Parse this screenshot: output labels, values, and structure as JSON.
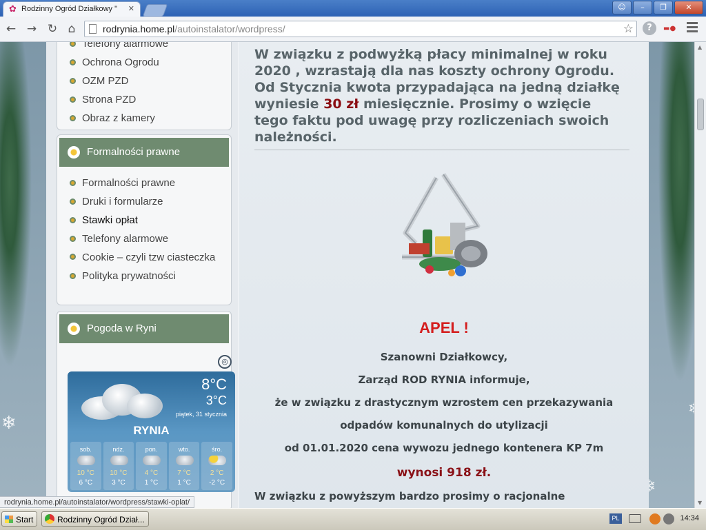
{
  "browser": {
    "tab_title": "Rodzinny Ogród Działkowy \"",
    "url_host": "rodrynia.home.pl",
    "url_path": "/autoinstalator/wordpress/",
    "status_url": "rodrynia.home.pl/autoinstalator/wordpress/stawki-oplat/"
  },
  "sidebar": {
    "menu_top": [
      {
        "label": "Telefony alarmowe"
      },
      {
        "label": "Ochrona Ogrodu"
      },
      {
        "label": "OZM PZD"
      },
      {
        "label": "Strona PZD"
      },
      {
        "label": "Obraz z kamery"
      }
    ],
    "formalnosci": {
      "title": "Formalności prawne",
      "items": [
        {
          "label": "Formalności prawne"
        },
        {
          "label": "Druki i formularze"
        },
        {
          "label": "Stawki opłat"
        },
        {
          "label": "Telefony alarmowe"
        },
        {
          "label": "Cookie – czyli tzw ciasteczka"
        },
        {
          "label": "Polityka prywatności"
        }
      ]
    },
    "weather_box": {
      "title": "Pogoda w Ryni"
    }
  },
  "weather": {
    "temp_high": "8°C",
    "temp_low": "3°C",
    "date": "piątek, 31 stycznia",
    "city": "RYNIA",
    "forecast": [
      {
        "day": "sob.",
        "high": "10 °C",
        "low": "6 °C",
        "icon": "cloud-icon"
      },
      {
        "day": "ndz.",
        "high": "10 °C",
        "low": "3 °C",
        "icon": "cloud-icon"
      },
      {
        "day": "pon.",
        "high": "4 °C",
        "low": "1 °C",
        "icon": "cloud-rain-icon"
      },
      {
        "day": "wto.",
        "high": "7 °C",
        "low": "1 °C",
        "icon": "cloud-icon"
      },
      {
        "day": "śro.",
        "high": "2 °C",
        "low": "-2 °C",
        "icon": "sun-cloud-icon"
      }
    ]
  },
  "content": {
    "intro_before": "W związku z podwyżką płacy minimalnej w roku 2020 , wzrastają dla nas koszty ochrony Ogrodu. Od Stycznia kwota przypadająca na jedną działkę wyniesie ",
    "intro_amount": "30 zł",
    "intro_after": " miesięcznie. Prosimy o wzięcie tego faktu pod uwagę przy  rozliczeniach swoich należności.",
    "apel": "APEL !",
    "lines": [
      "Szanowni Działkowcy,",
      "Zarząd ROD RYNIA informuje,",
      "że w związku z drastycznym wzrostem cen przekazywania",
      "odpadów komunalnych do utylizacji",
      "od 01.01.2020 cena wywozu jednego kontenera KP 7m"
    ],
    "price": "wynosi 918 zł.",
    "cutoff": "W związku z powyższym bardzo prosimy o racjonalne"
  },
  "taskbar": {
    "start": "Start",
    "task": "Rodzinny Ogród Dział...",
    "lang": "PL",
    "clock": "14:34"
  },
  "colors": {
    "accent_green": "#6f8b70",
    "highlight_red": "#8b0d12",
    "apel_red": "#d41d1d"
  }
}
